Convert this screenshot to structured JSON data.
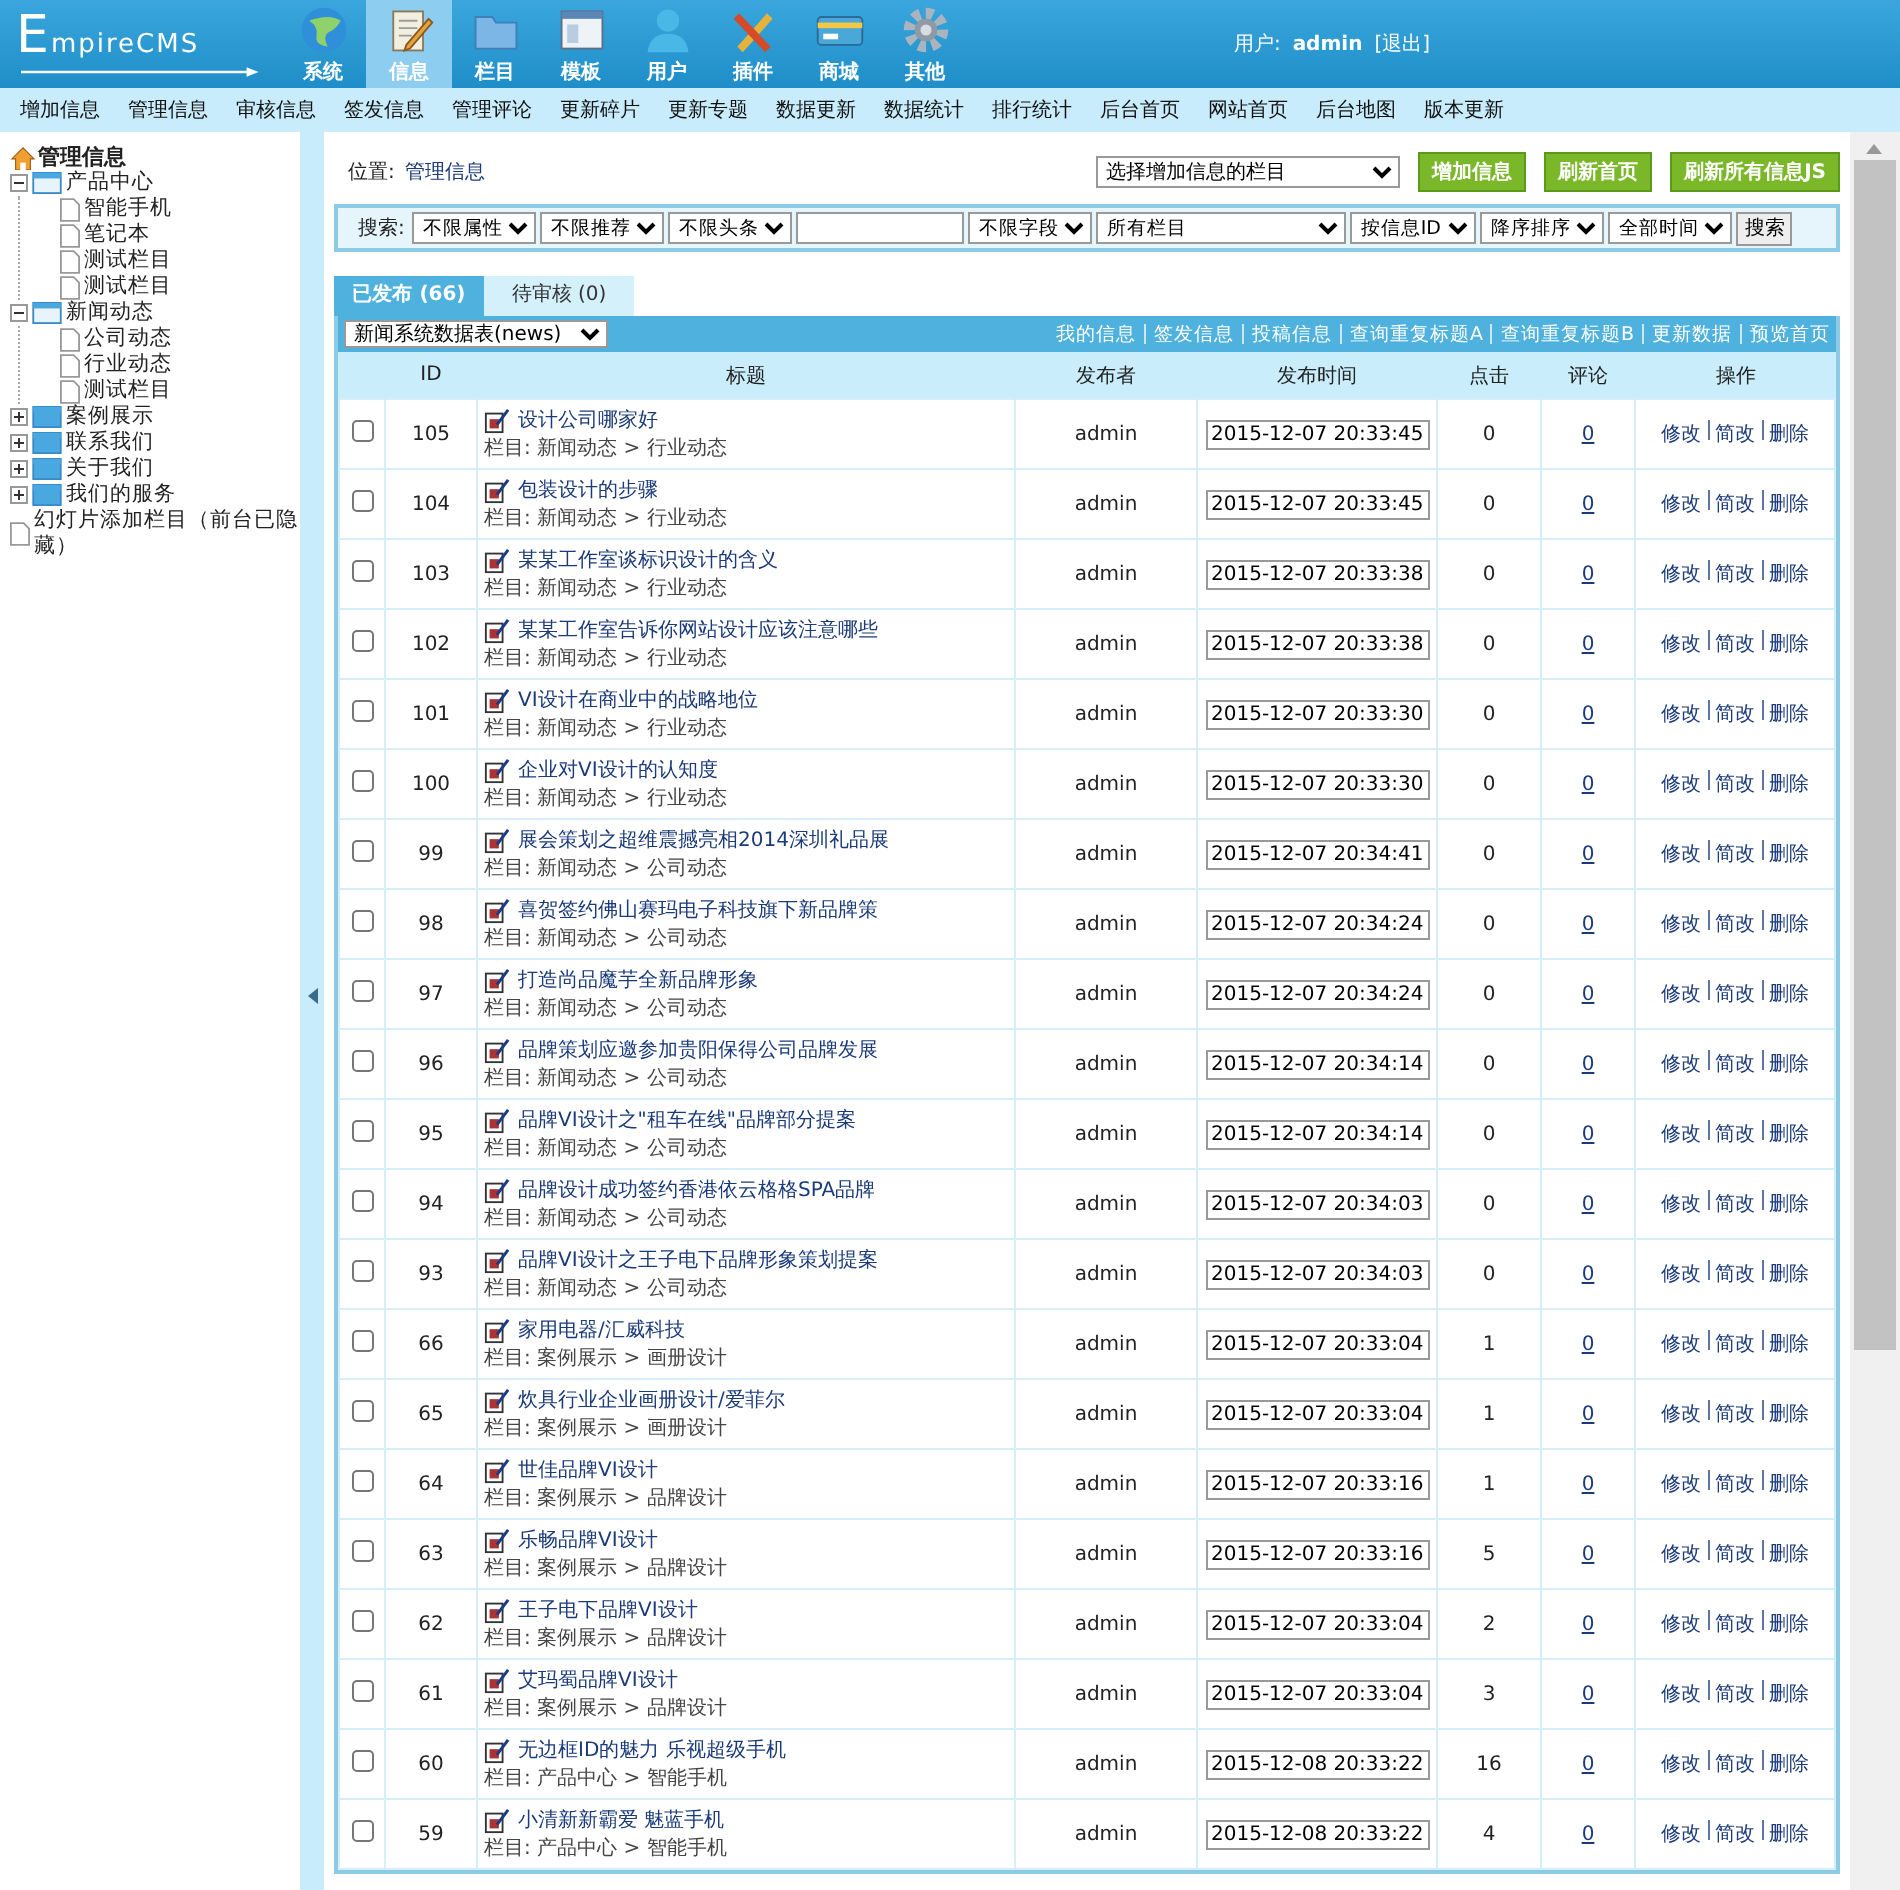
{
  "header": {
    "logo": "EmpireCMS",
    "modules": [
      {
        "label": "系统",
        "kind": "globe",
        "selected": false
      },
      {
        "label": "信息",
        "kind": "notepad",
        "selected": true
      },
      {
        "label": "栏目",
        "kind": "folder",
        "selected": false
      },
      {
        "label": "模板",
        "kind": "window",
        "selected": false
      },
      {
        "label": "用户",
        "kind": "person",
        "selected": false
      },
      {
        "label": "插件",
        "kind": "tools",
        "selected": false
      },
      {
        "label": "商城",
        "kind": "card",
        "selected": false
      },
      {
        "label": "其他",
        "kind": "gear",
        "selected": false
      }
    ],
    "user_label": "用户:",
    "user": "admin",
    "logout": "[退出]"
  },
  "subnav": [
    "增加信息",
    "管理信息",
    "审核信息",
    "签发信息",
    "管理评论",
    "更新碎片",
    "更新专题",
    "数据更新",
    "数据统计",
    "排行统计",
    "后台首页",
    "网站首页",
    "后台地图",
    "版本更新"
  ],
  "sidebar": {
    "title": "管理信息",
    "tree": [
      {
        "label": "产品中心",
        "expanded": true,
        "children": [
          {
            "label": "智能手机"
          },
          {
            "label": "笔记本"
          },
          {
            "label": "测试栏目"
          },
          {
            "label": "测试栏目"
          }
        ]
      },
      {
        "label": "新闻动态",
        "expanded": true,
        "children": [
          {
            "label": "公司动态"
          },
          {
            "label": "行业动态"
          },
          {
            "label": "测试栏目"
          }
        ]
      },
      {
        "label": "案例展示",
        "expanded": false
      },
      {
        "label": "联系我们",
        "expanded": false
      },
      {
        "label": "关于我们",
        "expanded": false
      },
      {
        "label": "我们的服务",
        "expanded": false
      },
      {
        "label": "幻灯片添加栏目（前台已隐藏）"
      }
    ]
  },
  "location": {
    "label": "位置:",
    "value": "管理信息"
  },
  "add_bar": {
    "column_select": "选择增加信息的栏目",
    "buttons": [
      "增加信息",
      "刷新首页",
      "刷新所有信息JS"
    ]
  },
  "search": {
    "label": "搜索:",
    "selects_before": [
      "不限属性",
      "不限推荐",
      "不限头条"
    ],
    "selects_after": [
      "不限字段",
      "所有栏目",
      "按信息ID",
      "降序排序",
      "全部时间"
    ],
    "button": "搜索"
  },
  "tabs": [
    {
      "label": "已发布 (66)",
      "selected": true
    },
    {
      "label": "待审核 (0)",
      "selected": false
    }
  ],
  "table": {
    "table_select": "新闻系统数据表(news)",
    "links": [
      "我的信息",
      "签发信息",
      "投稿信息",
      "查询重复标题A",
      "查询重复标题B",
      "更新数据",
      "预览首页"
    ],
    "columns": [
      "ID",
      "标题",
      "发布者",
      "发布时间",
      "点击",
      "评论",
      "操作"
    ],
    "rows": [
      {
        "id": "105",
        "title": "设计公司哪家好",
        "category": "栏目: 新闻动态 > 行业动态",
        "publisher": "admin",
        "time": "2015-12-07 20:33:45",
        "clicks": "0",
        "comments": "0",
        "actions": [
          "修改",
          "简改",
          "删除"
        ],
        "checked": false
      },
      {
        "id": "104",
        "title": "包装设计的步骤",
        "category": "栏目: 新闻动态 > 行业动态",
        "publisher": "admin",
        "time": "2015-12-07 20:33:45",
        "clicks": "0",
        "comments": "0",
        "actions": [
          "修改",
          "简改",
          "删除"
        ],
        "checked": false
      },
      {
        "id": "103",
        "title": "某某工作室谈标识设计的含义",
        "category": "栏目: 新闻动态 > 行业动态",
        "publisher": "admin",
        "time": "2015-12-07 20:33:38",
        "clicks": "0",
        "comments": "0",
        "actions": [
          "修改",
          "简改",
          "删除"
        ],
        "checked": false
      },
      {
        "id": "102",
        "title": "某某工作室告诉你网站设计应该注意哪些",
        "category": "栏目: 新闻动态 > 行业动态",
        "publisher": "admin",
        "time": "2015-12-07 20:33:38",
        "clicks": "0",
        "comments": "0",
        "actions": [
          "修改",
          "简改",
          "删除"
        ],
        "checked": false
      },
      {
        "id": "101",
        "title": "VI设计在商业中的战略地位",
        "category": "栏目: 新闻动态 > 行业动态",
        "publisher": "admin",
        "time": "2015-12-07 20:33:30",
        "clicks": "0",
        "comments": "0",
        "actions": [
          "修改",
          "简改",
          "删除"
        ],
        "checked": false
      },
      {
        "id": "100",
        "title": "企业对VI设计的认知度",
        "category": "栏目: 新闻动态 > 行业动态",
        "publisher": "admin",
        "time": "2015-12-07 20:33:30",
        "clicks": "0",
        "comments": "0",
        "actions": [
          "修改",
          "简改",
          "删除"
        ],
        "checked": false
      },
      {
        "id": "99",
        "title": "展会策划之超维震撼亮相2014深圳礼品展",
        "category": "栏目: 新闻动态 > 公司动态",
        "publisher": "admin",
        "time": "2015-12-07 20:34:41",
        "clicks": "0",
        "comments": "0",
        "actions": [
          "修改",
          "简改",
          "删除"
        ],
        "checked": false
      },
      {
        "id": "98",
        "title": "喜贺签约佛山赛玛电子科技旗下新品牌策",
        "category": "栏目: 新闻动态 > 公司动态",
        "publisher": "admin",
        "time": "2015-12-07 20:34:24",
        "clicks": "0",
        "comments": "0",
        "actions": [
          "修改",
          "简改",
          "删除"
        ],
        "checked": false
      },
      {
        "id": "97",
        "title": "打造尚品魔芋全新品牌形象",
        "category": "栏目: 新闻动态 > 公司动态",
        "publisher": "admin",
        "time": "2015-12-07 20:34:24",
        "clicks": "0",
        "comments": "0",
        "actions": [
          "修改",
          "简改",
          "删除"
        ],
        "checked": false
      },
      {
        "id": "96",
        "title": "品牌策划应邀参加贵阳保得公司品牌发展",
        "category": "栏目: 新闻动态 > 公司动态",
        "publisher": "admin",
        "time": "2015-12-07 20:34:14",
        "clicks": "0",
        "comments": "0",
        "actions": [
          "修改",
          "简改",
          "删除"
        ],
        "checked": false
      },
      {
        "id": "95",
        "title": "品牌VI设计之\"租车在线\"品牌部分提案",
        "category": "栏目: 新闻动态 > 公司动态",
        "publisher": "admin",
        "time": "2015-12-07 20:34:14",
        "clicks": "0",
        "comments": "0",
        "actions": [
          "修改",
          "简改",
          "删除"
        ],
        "checked": false
      },
      {
        "id": "94",
        "title": "品牌设计成功签约香港依云格格SPA品牌",
        "category": "栏目: 新闻动态 > 公司动态",
        "publisher": "admin",
        "time": "2015-12-07 20:34:03",
        "clicks": "0",
        "comments": "0",
        "actions": [
          "修改",
          "简改",
          "删除"
        ],
        "checked": false
      },
      {
        "id": "93",
        "title": "品牌VI设计之王子电下品牌形象策划提案",
        "category": "栏目: 新闻动态 > 公司动态",
        "publisher": "admin",
        "time": "2015-12-07 20:34:03",
        "clicks": "0",
        "comments": "0",
        "actions": [
          "修改",
          "简改",
          "删除"
        ],
        "checked": false
      },
      {
        "id": "66",
        "title": "家用电器/汇威科技",
        "category": "栏目: 案例展示 > 画册设计",
        "publisher": "admin",
        "time": "2015-12-07 20:33:04",
        "clicks": "1",
        "comments": "0",
        "actions": [
          "修改",
          "简改",
          "删除"
        ],
        "checked": false
      },
      {
        "id": "65",
        "title": "炊具行业企业画册设计/爱菲尔",
        "category": "栏目: 案例展示 > 画册设计",
        "publisher": "admin",
        "time": "2015-12-07 20:33:04",
        "clicks": "1",
        "comments": "0",
        "actions": [
          "修改",
          "简改",
          "删除"
        ],
        "checked": false
      },
      {
        "id": "64",
        "title": "世佳品牌VI设计",
        "category": "栏目: 案例展示 > 品牌设计",
        "publisher": "admin",
        "time": "2015-12-07 20:33:16",
        "clicks": "1",
        "comments": "0",
        "actions": [
          "修改",
          "简改",
          "删除"
        ],
        "checked": false
      },
      {
        "id": "63",
        "title": "乐畅品牌VI设计",
        "category": "栏目: 案例展示 > 品牌设计",
        "publisher": "admin",
        "time": "2015-12-07 20:33:16",
        "clicks": "5",
        "comments": "0",
        "actions": [
          "修改",
          "简改",
          "删除"
        ],
        "checked": false
      },
      {
        "id": "62",
        "title": "王子电下品牌VI设计",
        "category": "栏目: 案例展示 > 品牌设计",
        "publisher": "admin",
        "time": "2015-12-07 20:33:04",
        "clicks": "2",
        "comments": "0",
        "actions": [
          "修改",
          "简改",
          "删除"
        ],
        "checked": false
      },
      {
        "id": "61",
        "title": "艾玛蜀品牌VI设计",
        "category": "栏目: 案例展示 > 品牌设计",
        "publisher": "admin",
        "time": "2015-12-07 20:33:04",
        "clicks": "3",
        "comments": "0",
        "actions": [
          "修改",
          "简改",
          "删除"
        ],
        "checked": false
      },
      {
        "id": "60",
        "title": "无边框ID的魅力 乐视超级手机",
        "category": "栏目: 产品中心 > 智能手机",
        "publisher": "admin",
        "time": "2015-12-08 20:33:22",
        "clicks": "16",
        "comments": "0",
        "actions": [
          "修改",
          "简改",
          "删除"
        ],
        "checked": false
      },
      {
        "id": "59",
        "title": "小清新新霸爱 魅蓝手机",
        "category": "栏目: 产品中心 > 智能手机",
        "publisher": "admin",
        "time": "2015-12-08 20:33:22",
        "clicks": "4",
        "comments": "0",
        "actions": [
          "修改",
          "简改",
          "删除"
        ],
        "checked": false
      }
    ]
  }
}
